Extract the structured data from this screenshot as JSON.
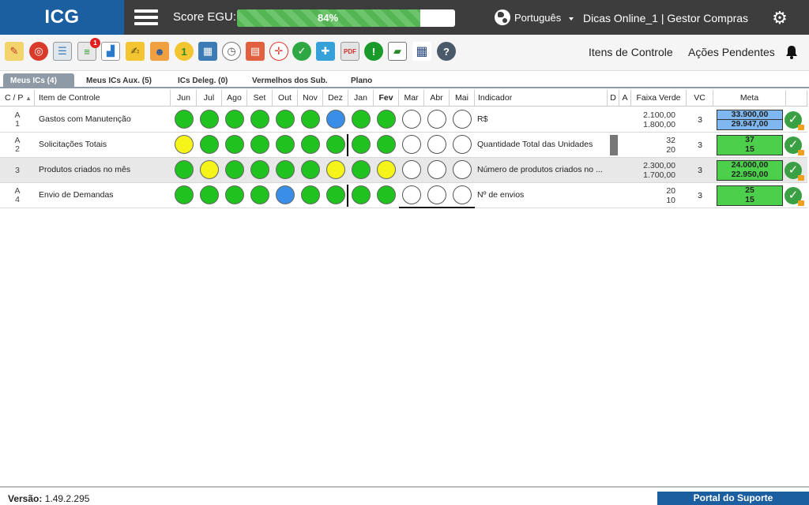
{
  "app": {
    "logo": "ICG",
    "score_label": "Score EGU:",
    "score_percent": 0.84,
    "score_text": "84%",
    "language": "Português",
    "user_label": "Dicas Online_1  |  Gestor Compras"
  },
  "toolbar": {
    "icons": [
      "edit-icon",
      "target-icon",
      "clipboard-icon",
      "alerts-icon",
      "chart-icon",
      "contract-icon",
      "team-icon",
      "medal-icon",
      "calendar-icon",
      "stopwatch-icon",
      "hierarchy-icon",
      "crosshair-icon",
      "check-icon",
      "puzzle-icon",
      "pdf-icon",
      "off-icon",
      "presentation-icon",
      "grid-icon",
      "help-icon"
    ],
    "alert_badge": "1",
    "links": {
      "itens_controle": "Itens de Controle",
      "acoes_pendentes": "Ações Pendentes"
    }
  },
  "tabs": [
    "Meus ICs (4)",
    "Meus ICs Aux. (5)",
    "ICs Deleg. (0)",
    "Vermelhos dos Sub.",
    "Plano"
  ],
  "columns": {
    "cp": "C / P",
    "item": "Item de Controle",
    "months": [
      "Jun",
      "Jul",
      "Ago",
      "Set",
      "Out",
      "Nov",
      "Dez",
      "Jan",
      "Fev",
      "Mar",
      "Abr",
      "Mai"
    ],
    "indicador": "Indicador",
    "d": "D",
    "a": "A",
    "faixa": "Faixa Verde",
    "vc": "VC",
    "meta": "Meta"
  },
  "rows": [
    {
      "cp1": "A",
      "cp2": "1",
      "item": "Gastos com Manutenção",
      "dots": [
        "g",
        "g",
        "g",
        "g",
        "g",
        "g",
        "b",
        "g",
        "g",
        "e",
        "e",
        "e"
      ],
      "indicador": "R$",
      "faixa1": "2.100,00",
      "faixa2": "1.800,00",
      "vc": "3",
      "meta1": "33.900,00",
      "meta2": "29.947,00",
      "meta_color": "#7fb8f0"
    },
    {
      "cp1": "A",
      "cp2": "2",
      "item": "Solicitações Totais",
      "dots": [
        "y",
        "g",
        "g",
        "g",
        "g",
        "g",
        "g",
        "g",
        "g",
        "e",
        "e",
        "e"
      ],
      "indicador": "Quantidade Total das Unidades",
      "faixa1": "32",
      "faixa2": "20",
      "vc": "3",
      "meta1": "37",
      "meta2": "15",
      "meta_color": "#4cd04c"
    },
    {
      "cp1": "",
      "cp2": "3",
      "item": "Produtos criados no mês",
      "dots": [
        "g",
        "y",
        "g",
        "g",
        "g",
        "g",
        "y",
        "g",
        "y",
        "e",
        "e",
        "e"
      ],
      "indicador": "Número de produtos criados no ...",
      "faixa1": "2.300,00",
      "faixa2": "1.700,00",
      "vc": "3",
      "meta1": "24.000,00",
      "meta2": "22.950,00",
      "meta_color": "#4cd04c"
    },
    {
      "cp1": "A",
      "cp2": "4",
      "item": "Envio de Demandas",
      "dots": [
        "g",
        "g",
        "g",
        "g",
        "b",
        "g",
        "g",
        "g",
        "g",
        "e",
        "e",
        "e"
      ],
      "indicador": "Nº de envios",
      "faixa1": "20",
      "faixa2": "10",
      "vc": "3",
      "meta1": "25",
      "meta2": "15",
      "meta_color": "#4cd04c"
    }
  ],
  "colors": {
    "g": "#1fc21f",
    "y": "#f5f51a",
    "b": "#3a8ee8",
    "e": "#ffffff"
  },
  "footer": {
    "version_label": "Versão:",
    "version": "1.49.2.295",
    "portal": "Portal do Suporte"
  }
}
